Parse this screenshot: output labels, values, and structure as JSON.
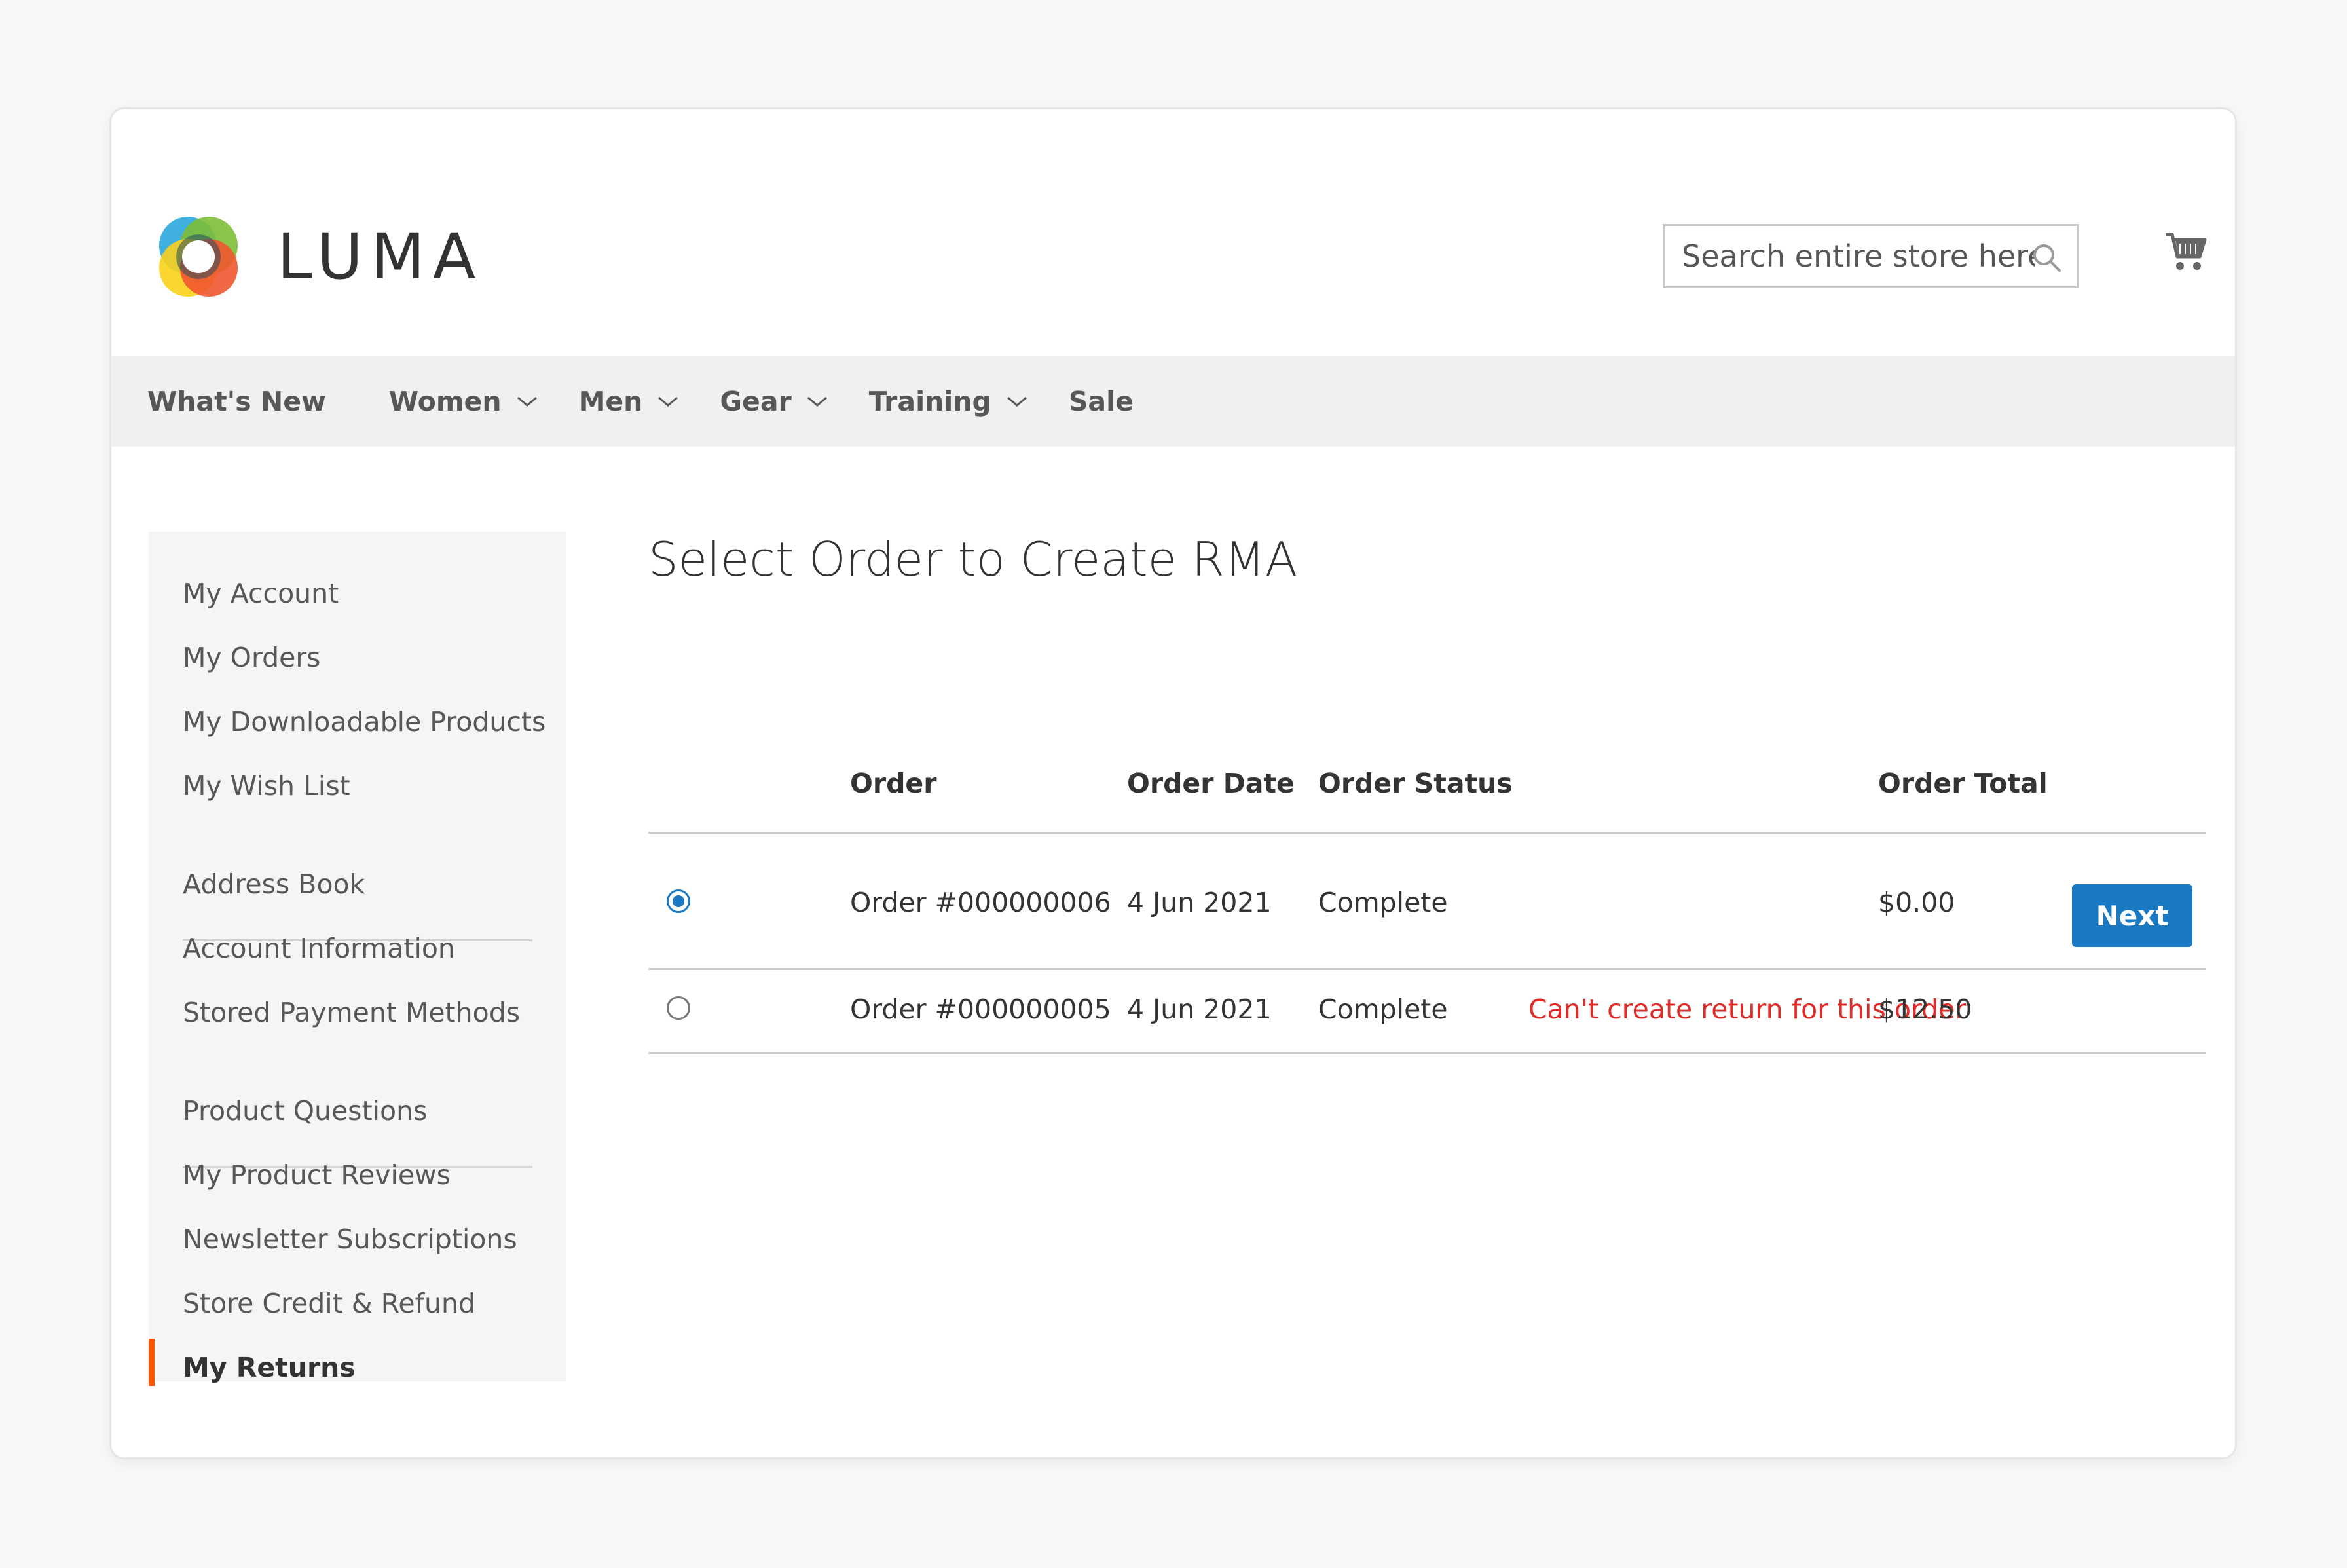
{
  "brand": {
    "name": "LUMA"
  },
  "search": {
    "placeholder": "Search entire store here..."
  },
  "nav": [
    {
      "label": "What's New",
      "dropdown": false
    },
    {
      "label": "Women",
      "dropdown": true
    },
    {
      "label": "Men",
      "dropdown": true
    },
    {
      "label": "Gear",
      "dropdown": true
    },
    {
      "label": "Training",
      "dropdown": true
    },
    {
      "label": "Sale",
      "dropdown": false
    }
  ],
  "sidebar": {
    "items": [
      "My Account",
      "My Orders",
      "My Downloadable Products",
      "My Wish List",
      "Address Book",
      "Account Information",
      "Stored Payment Methods",
      "Product Questions",
      "My Product Reviews",
      "Newsletter Subscriptions",
      "Store Credit & Refund",
      "My Returns"
    ],
    "active": "My Returns"
  },
  "page": {
    "title": "Select Order to Create RMA"
  },
  "table": {
    "columns": {
      "order": "Order",
      "date": "Order Date",
      "status": "Order Status",
      "total": "Order Total"
    },
    "rows": [
      {
        "order": "Order #000000006",
        "date": "4 Jun 2021",
        "status": "Complete",
        "note": "",
        "total": "$0.00",
        "selected": true
      },
      {
        "order": "Order #000000005",
        "date": "4 Jun 2021",
        "status": "Complete",
        "note": "Can't create return for this order",
        "total": "$12.50",
        "selected": false
      }
    ],
    "next_label": "Next"
  },
  "colors": {
    "accent": "#1979c3",
    "error": "#e02b27",
    "active_marker": "#ff5501"
  },
  "icons": {
    "search": "search-icon",
    "cart": "cart-icon",
    "dropdown": "chevron-down-icon"
  }
}
